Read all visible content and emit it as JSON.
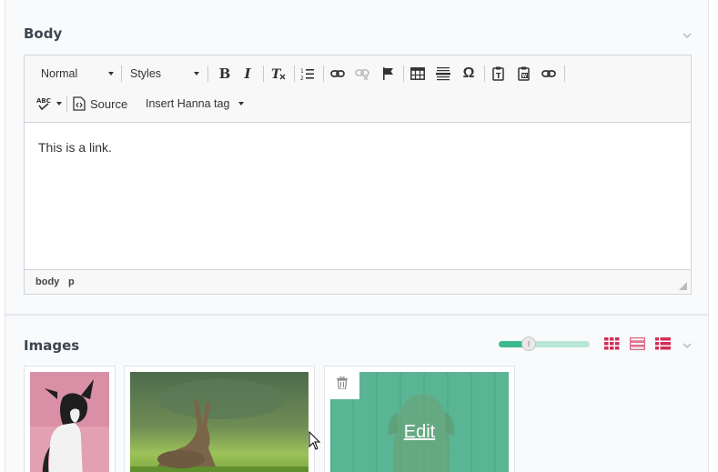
{
  "body_panel": {
    "title": "Body",
    "toolbar": {
      "format_combo": "Normal",
      "styles_combo": "Styles",
      "buttons": {
        "bold": "B",
        "italic": "I",
        "special_char": "Ω",
        "source": "Source",
        "hanna_tag": "Insert Hanna tag",
        "spellcheck": "ABC"
      }
    },
    "content_text": "This is a link.",
    "path": [
      "body",
      "p"
    ]
  },
  "images_panel": {
    "title": "Images",
    "size_slider_level_percent": 33,
    "view_buttons": [
      "grid-large-icon",
      "grid-list-icon",
      "list-icon"
    ],
    "edit_overlay_label": "Edit",
    "images": [
      {
        "subject": "dog on pink background"
      },
      {
        "subject": "hare in grass field"
      },
      {
        "subject": "dog behind wooden fence"
      }
    ]
  },
  "colors": {
    "accent_green": "#3cb98d",
    "view_icon_red": "#d42e58",
    "panel_bg": "#f9fafb"
  }
}
